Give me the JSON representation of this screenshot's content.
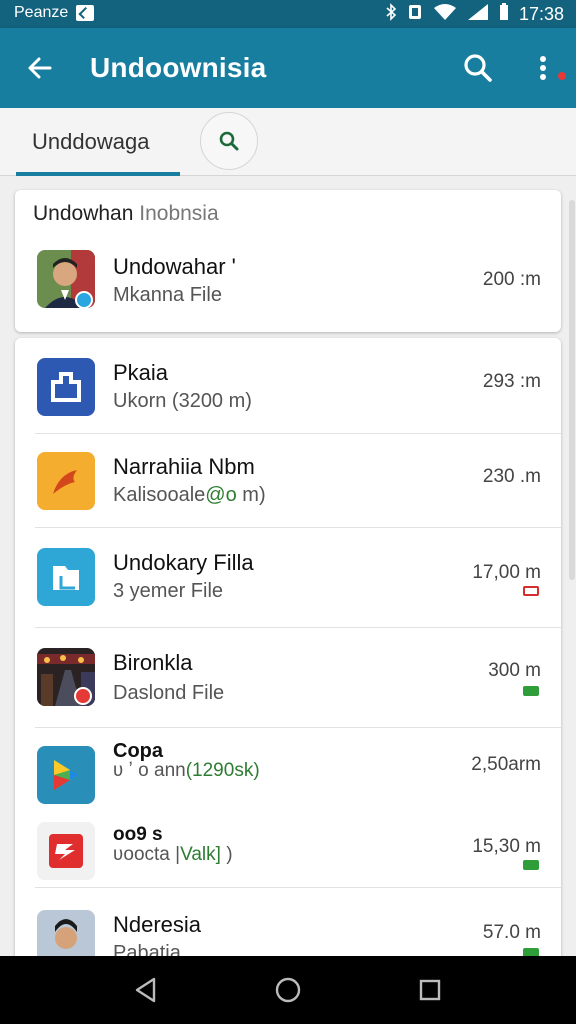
{
  "status_bar": {
    "left_text": "Peanze",
    "time": "17:38"
  },
  "app_bar": {
    "title": "Undoownisia"
  },
  "tabs": {
    "active_label": "Unddowaga"
  },
  "featured": {
    "header_bold": "Undowhan",
    "header_dim": "Inobnsia",
    "item": {
      "title": "Undowahar '",
      "subtitle": "Mkanna File",
      "size": "200 :m"
    }
  },
  "list": [
    {
      "title": "Pkaia",
      "subtitle": "Ukorn (3200 m)",
      "size": "293 :m",
      "icon": "blue-app-icon",
      "badge": ""
    },
    {
      "title": "Narrahiia Nbm",
      "subtitle_prefix": "Kalisooale",
      "subtitle_green": "@o",
      "subtitle_suffix": " m)",
      "size": "230 .m",
      "icon": "orange-app-icon",
      "badge": ""
    },
    {
      "title": "Undokary Filla",
      "subtitle": "3  yemer File",
      "size": "17,00 m",
      "icon": "folder-app-icon",
      "badge": "red"
    },
    {
      "title": "Bironkla",
      "subtitle": "Daslond File",
      "size": "300 m",
      "icon": "city-photo-icon",
      "badge": "green"
    },
    {
      "title": "Copa",
      "subtitle_prefix": "ʋ ʼ o  ann",
      "subtitle_green": "(1290sk)",
      "subtitle_suffix": "",
      "size": "2,50arm",
      "icon": "play-store-icon",
      "badge": ""
    },
    {
      "title": "oo9 s",
      "subtitle_prefix": "ʋoocta |",
      "subtitle_green": "Valk]",
      "subtitle_suffix": " )",
      "size": "15,30 m",
      "icon": "red-app-icon",
      "badge": "green"
    },
    {
      "title": "Nderesia",
      "subtitle": "Pabatia",
      "size": "57.0 m",
      "icon": "person-photo-icon",
      "badge": "green"
    }
  ],
  "colors": {
    "status_bar": "#13627e",
    "app_bar": "#187e9f",
    "accent": "#187e9f"
  }
}
